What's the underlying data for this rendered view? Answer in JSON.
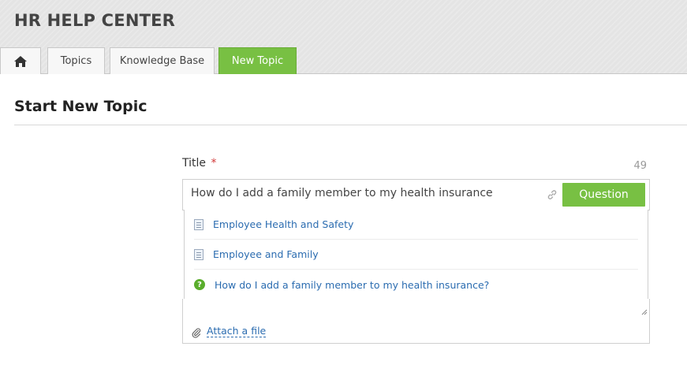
{
  "app": {
    "title": "HR HELP CENTER"
  },
  "tabs": [
    {
      "label": "",
      "icon": "home-icon"
    },
    {
      "label": "Topics"
    },
    {
      "label": "Knowledge Base"
    },
    {
      "label": "New Topic",
      "active": true
    }
  ],
  "page": {
    "title": "Start New Topic"
  },
  "form": {
    "title_label": "Title",
    "required_marker": "*",
    "char_count": "49",
    "title_value": "How do I add a family member to my health insurance",
    "type_button": "Question",
    "attach_label": "Attach a file"
  },
  "suggestions": [
    {
      "label": "Employee Health and Safety",
      "icon": "document-icon"
    },
    {
      "label": "Employee and Family",
      "icon": "document-icon"
    },
    {
      "label": "How do I add a family member to my health insurance?",
      "icon": "question-icon"
    }
  ],
  "colors": {
    "accent_green": "#78c043",
    "link_blue": "#2b6cb0",
    "required_red": "#d23a3a"
  }
}
